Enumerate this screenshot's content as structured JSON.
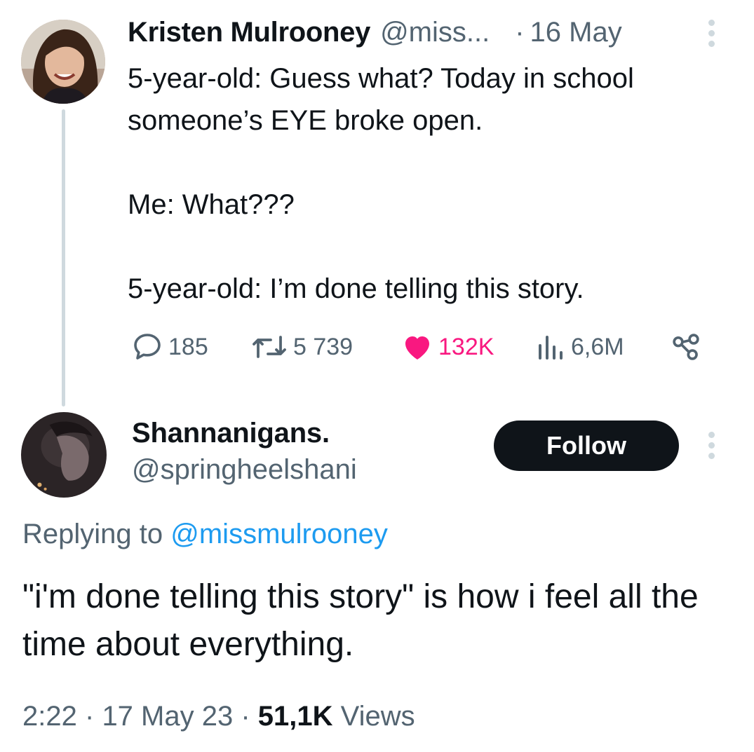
{
  "parent_tweet": {
    "author_name": "Kristen Mulrooney",
    "author_handle": "@miss...",
    "separator": "·",
    "date": "16 May",
    "lines": [
      "5-year-old: Guess what? Today in school",
      "someone’s EYE broke open.",
      "",
      "Me: What???",
      "",
      "5-year-old: I’m done telling this story."
    ],
    "actions": {
      "reply_count": "185",
      "retweet_count": "5 739",
      "like_count": "132K",
      "view_count": "6,6M"
    },
    "icons": [
      "reply-icon",
      "retweet-icon",
      "like-icon",
      "views-icon",
      "share-icon",
      "more-icon"
    ],
    "colors": {
      "like": "#f91880",
      "secondary_text": "#536471"
    }
  },
  "reply_tweet": {
    "author_name": "Shannanigans.",
    "author_handle": "@springheelshani",
    "follow_label": "Follow",
    "replying_prefix": "Replying to",
    "replying_mention": "@missmulrooney",
    "text": "\"i'm done telling this story\" is how i feel all the time about everything.",
    "meta": {
      "time": "2:22",
      "separator": "·",
      "date": "17 May 23",
      "views_count": "51,1K",
      "views_label": "Views"
    },
    "colors": {
      "mention": "#1d9bf0",
      "follow_bg": "#0f1419"
    }
  }
}
